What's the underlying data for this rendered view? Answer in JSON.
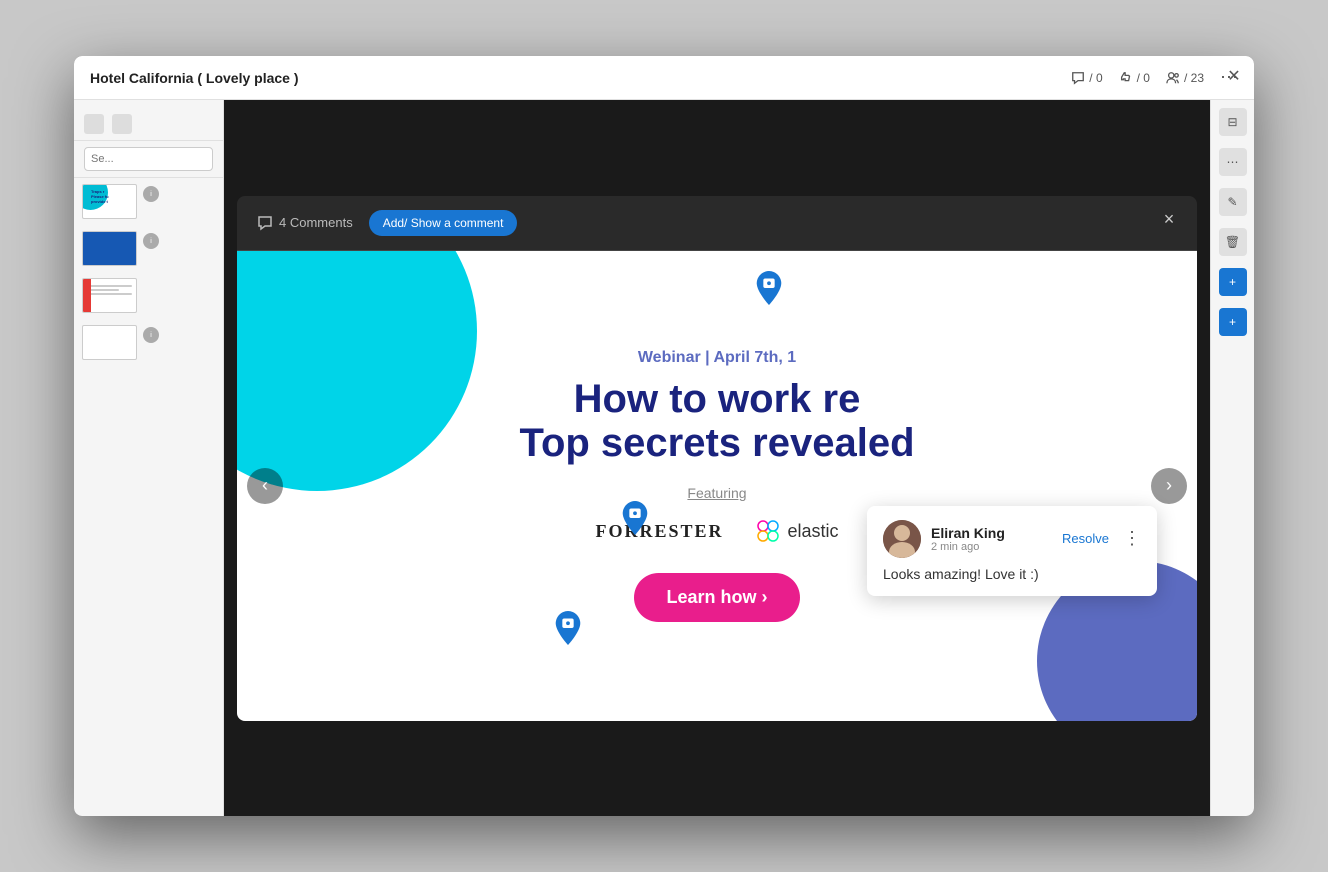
{
  "app": {
    "title": "Hotel California ( Lovely place )",
    "stats": {
      "comments": "/ 0",
      "likes": "/ 0",
      "users": "/ 23"
    }
  },
  "modal": {
    "close_label": "×",
    "comments_count": "4 Comments",
    "add_comment_btn": "Add/ Show a comment",
    "nav_left": "‹",
    "nav_right": "›"
  },
  "slide": {
    "webinar_label": "Webinar | April 7th, 1",
    "title_line1": "How to work re",
    "title_line2": "Top secrets revealed",
    "featuring": "Featuring",
    "logo_forrester": "FORRESTER",
    "logo_elastic": "elastic",
    "cta": "Learn how ›",
    "pin1_label": "comment-pin-1",
    "pin2_label": "comment-pin-2"
  },
  "comment": {
    "author": "Eliran King",
    "time": "2 min ago",
    "resolve_btn": "Resolve",
    "text": "Looks amazing! Love it :)"
  },
  "sidebar": {
    "search_placeholder": "Se...",
    "slides": [
      {
        "id": 1,
        "type": "text"
      },
      {
        "id": 2,
        "type": "image"
      },
      {
        "id": 3,
        "type": "list"
      },
      {
        "id": 4,
        "type": "person"
      }
    ]
  }
}
